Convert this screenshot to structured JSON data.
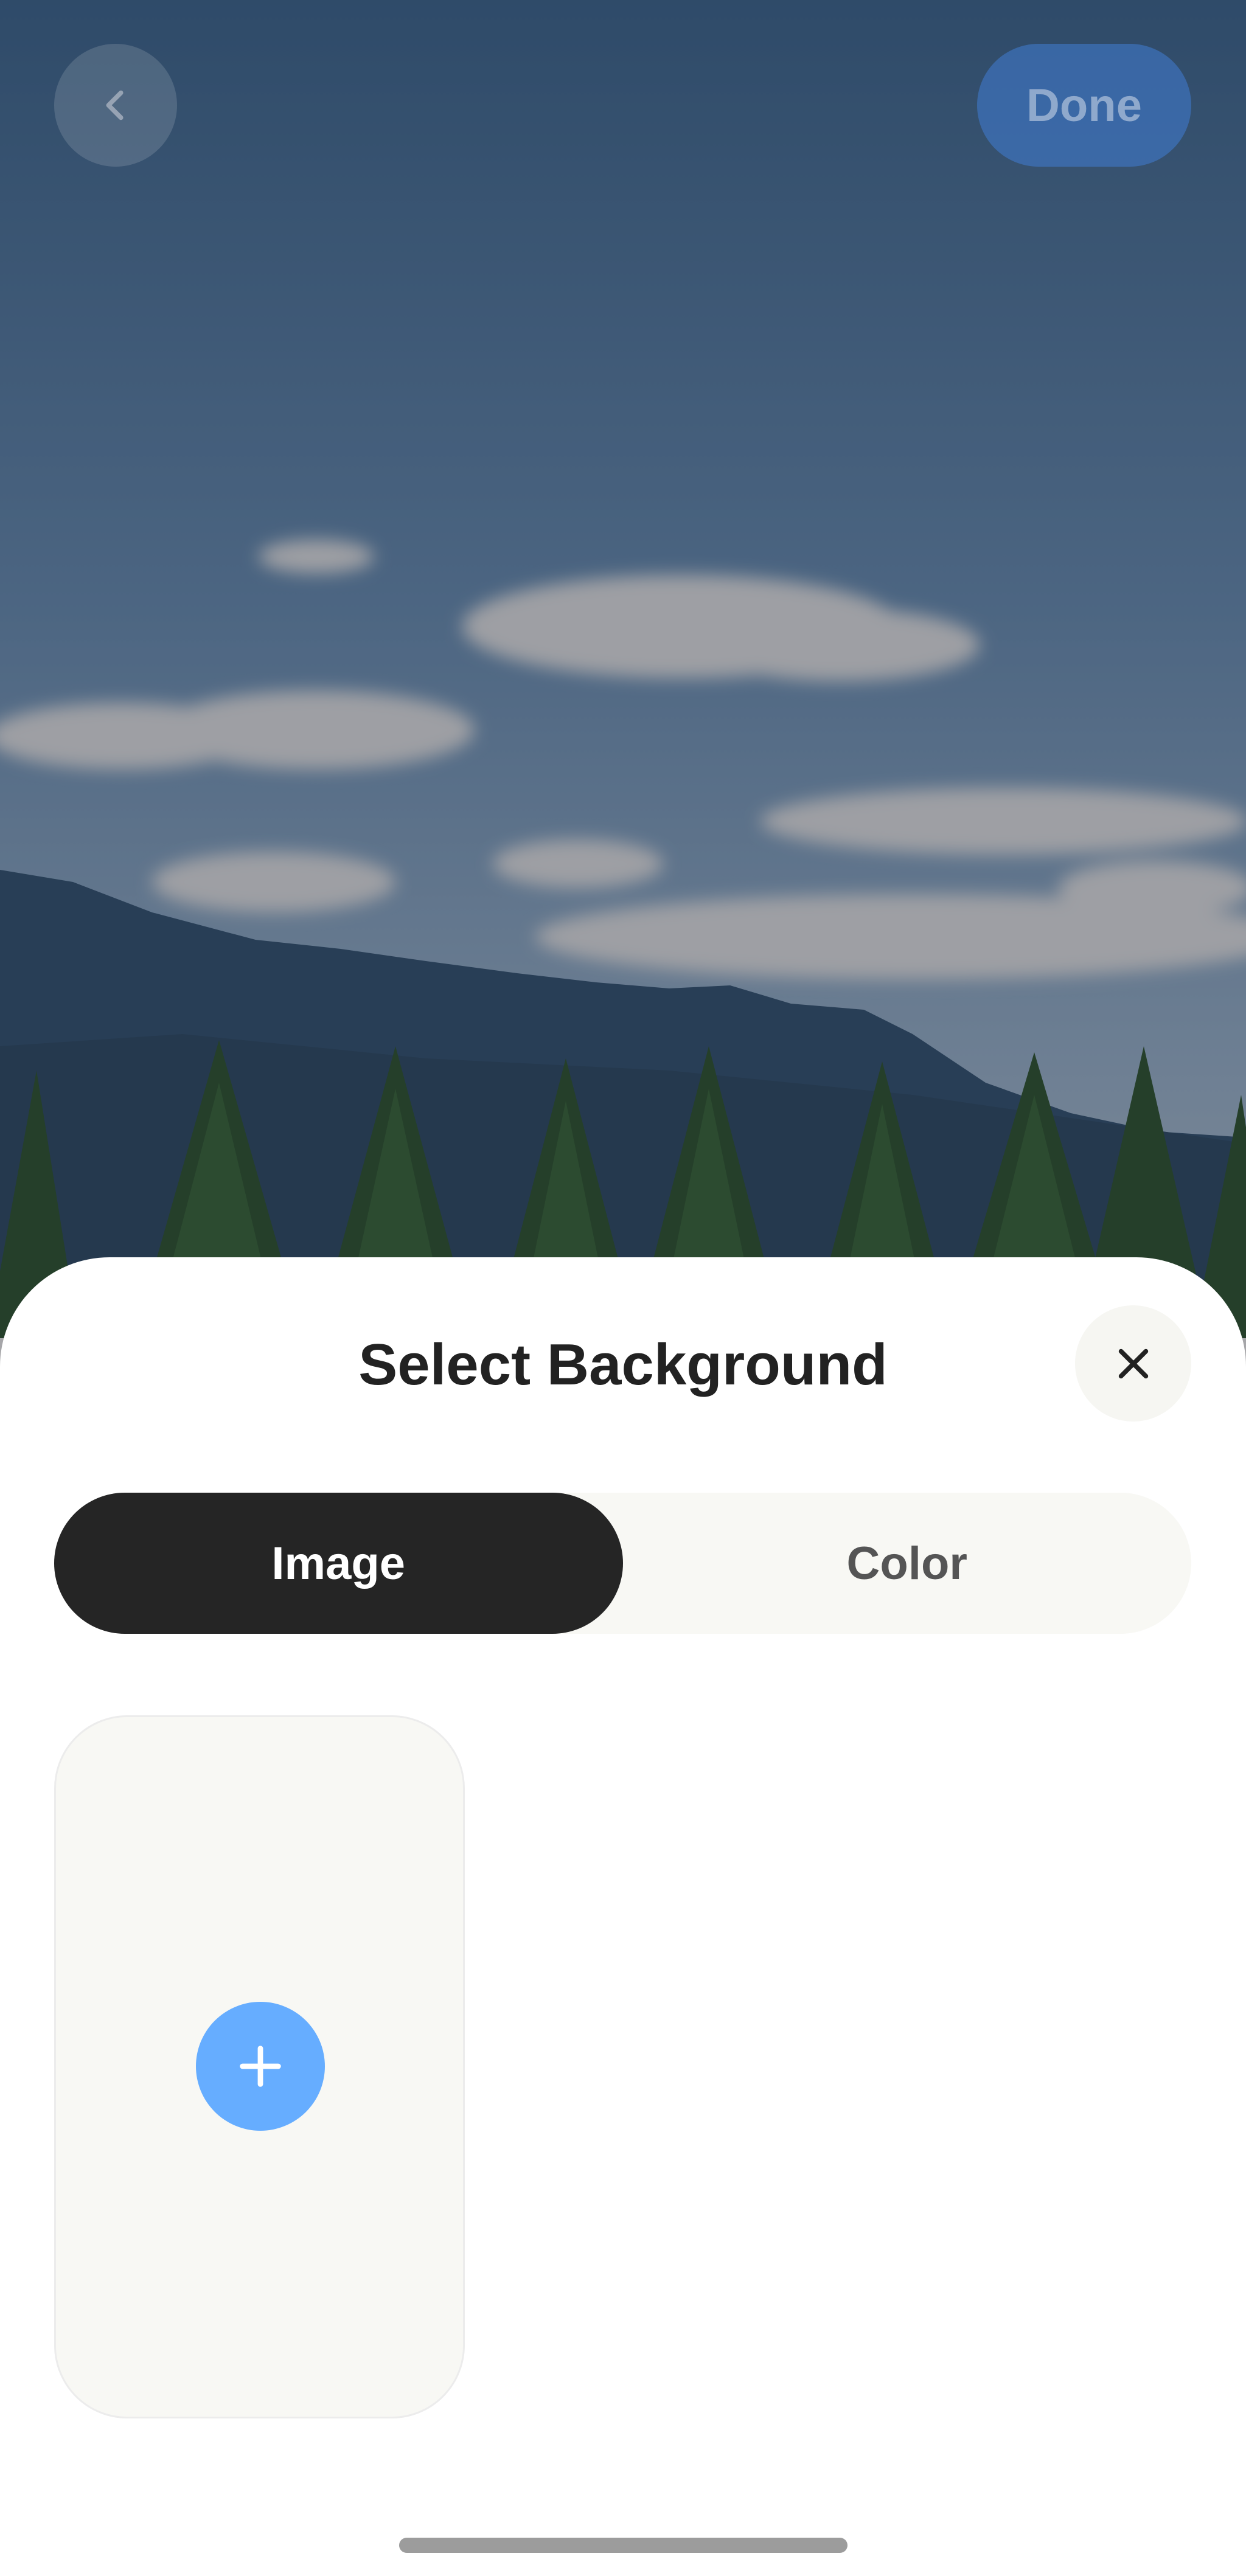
{
  "top_bar": {
    "back_icon": "chevron-left-icon",
    "done_label": "Done"
  },
  "sheet": {
    "title": "Select Background",
    "close_icon": "close-icon",
    "tabs": [
      {
        "label": "Image",
        "active": true
      },
      {
        "label": "Color",
        "active": false
      }
    ],
    "add_icon": "plus-icon"
  },
  "colors": {
    "accent": "#66adff",
    "active_tab": "#252525",
    "card_bg": "#f8f8f4"
  }
}
